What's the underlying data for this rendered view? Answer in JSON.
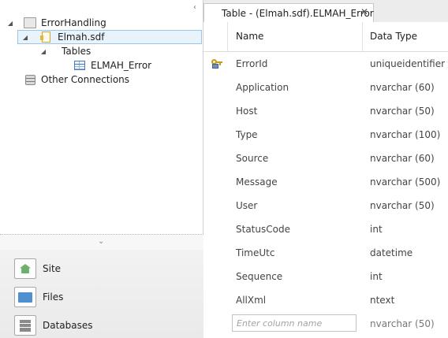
{
  "tree": {
    "root": {
      "label": "ErrorHandling",
      "toggle": "◢"
    },
    "db": {
      "label": "Elmah.sdf",
      "toggle": "◢"
    },
    "tables": {
      "label": "Tables",
      "toggle": "◢"
    },
    "table": {
      "label": "ELMAH_Error"
    },
    "other": {
      "label": "Other Connections"
    }
  },
  "nav": {
    "site": "Site",
    "files": "Files",
    "databases": "Databases"
  },
  "tab": {
    "title": "Table - (Elmah.sdf).ELMAH_Error",
    "close": "✕"
  },
  "grid": {
    "headers": {
      "name": "Name",
      "type": "Data Type"
    },
    "columns": [
      {
        "name": "ErrorId",
        "type": "uniqueidentifier",
        "key": true
      },
      {
        "name": "Application",
        "type": "nvarchar (60)"
      },
      {
        "name": "Host",
        "type": "nvarchar (50)"
      },
      {
        "name": "Type",
        "type": "nvarchar (100)"
      },
      {
        "name": "Source",
        "type": "nvarchar (60)"
      },
      {
        "name": "Message",
        "type": "nvarchar (500)"
      },
      {
        "name": "User",
        "type": "nvarchar (50)"
      },
      {
        "name": "StatusCode",
        "type": "int"
      },
      {
        "name": "TimeUtc",
        "type": "datetime"
      },
      {
        "name": "Sequence",
        "type": "int"
      },
      {
        "name": "AllXml",
        "type": "ntext"
      }
    ],
    "new_row": {
      "placeholder": "Enter column name",
      "type": "nvarchar (50)"
    }
  },
  "icons": {
    "root": "database-icon",
    "db": "sdf-file-icon",
    "table": "table-icon",
    "other": "connections-icon",
    "key": "primary-key-icon"
  }
}
